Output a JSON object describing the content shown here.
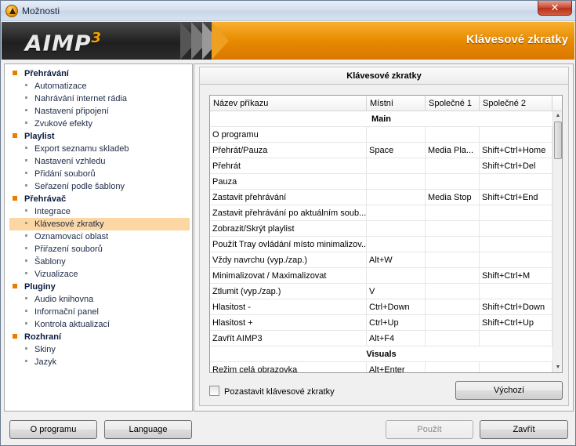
{
  "window": {
    "title": "Možnosti",
    "close_glyph": "✕"
  },
  "banner": {
    "logo": "AIMP",
    "logo_version": "3",
    "title": "Klávesové zkratky"
  },
  "sidebar": {
    "categories": [
      {
        "label": "Přehrávání",
        "items": [
          "Automatizace",
          "Nahrávání internet rádia",
          "Nastavení připojení",
          "Zvukové efekty"
        ]
      },
      {
        "label": "Playlist",
        "items": [
          "Export seznamu skladeb",
          "Nastavení vzhledu",
          "Přidání souborů",
          "Seřazení podle šablony"
        ]
      },
      {
        "label": "Přehrávač",
        "items": [
          "Integrace",
          "Klávesové zkratky",
          "Oznamovací oblast",
          "Přiřazení souborů",
          "Šablony",
          "Vizualizace"
        ]
      },
      {
        "label": "Pluginy",
        "items": [
          "Audio knihovna",
          "Informační panel",
          "Kontrola aktualizací"
        ]
      },
      {
        "label": "Rozhraní",
        "items": [
          "Skiny",
          "Jazyk"
        ]
      }
    ],
    "selected": "Klávesové zkratky"
  },
  "panel": {
    "title": "Klávesové zkratky",
    "columns": [
      "Název příkazu",
      "Místní",
      "Společné 1",
      "Společné 2"
    ],
    "rows": [
      {
        "group": "Main"
      },
      {
        "cells": [
          "O programu",
          "",
          "",
          ""
        ]
      },
      {
        "cells": [
          "Přehrát/Pauza",
          "Space",
          "Media Pla...",
          "Shift+Ctrl+Home"
        ]
      },
      {
        "cells": [
          "Přehrát",
          "",
          "",
          "Shift+Ctrl+Del"
        ]
      },
      {
        "cells": [
          "Pauza",
          "",
          "",
          ""
        ]
      },
      {
        "cells": [
          "Zastavit přehrávání",
          "",
          "Media Stop",
          "Shift+Ctrl+End"
        ]
      },
      {
        "cells": [
          "Zastavit přehrávání po aktuálním soub...",
          "",
          "",
          ""
        ]
      },
      {
        "cells": [
          "Zobrazit/Skrýt playlist",
          "",
          "",
          ""
        ]
      },
      {
        "cells": [
          "Použít Tray ovládání místo minimalizov...",
          "",
          "",
          ""
        ]
      },
      {
        "cells": [
          "Vždy navrchu (vyp./zap.)",
          "Alt+W",
          "",
          ""
        ]
      },
      {
        "cells": [
          "Minimalizovat / Maximalizovat",
          "",
          "",
          "Shift+Ctrl+M"
        ]
      },
      {
        "cells": [
          "Ztlumit (vyp./zap.)",
          "V",
          "",
          ""
        ]
      },
      {
        "cells": [
          "Hlasitost -",
          "Ctrl+Down",
          "",
          "Shift+Ctrl+Down"
        ]
      },
      {
        "cells": [
          "Hlasitost +",
          "Ctrl+Up",
          "",
          "Shift+Ctrl+Up"
        ]
      },
      {
        "cells": [
          "Zavřít AIMP3",
          "Alt+F4",
          "",
          ""
        ]
      },
      {
        "group": "Visuals"
      },
      {
        "cells": [
          "Režim celá obrazovka",
          "Alt+Enter",
          "",
          ""
        ]
      }
    ],
    "checkbox_label": "Pozastavit klávesové zkratky",
    "default_button": "Výchozí"
  },
  "footer": {
    "about_button": "O programu",
    "language_button": "Language",
    "apply_button": "Použít",
    "close_button": "Zavřít"
  },
  "colors": {
    "accent": "#e88a00",
    "selected_bg": "#fcd7a3",
    "banner_dark": "#2b2b2b"
  }
}
